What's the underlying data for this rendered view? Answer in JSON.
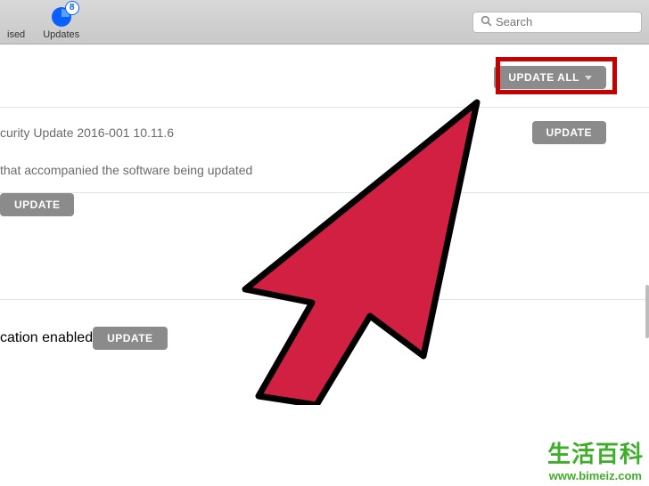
{
  "toolbar": {
    "purchased_label": "ised",
    "updates_label": "Updates",
    "updates_badge": "8",
    "search_placeholder": "Search"
  },
  "buttons": {
    "update_all": "UPDATE ALL",
    "update": "UPDATE"
  },
  "rows": {
    "item1_title": "curity Update 2016-001 10.11.6",
    "item1_desc": "that accompanied the software being updated",
    "item4_title": "cation enabled"
  },
  "watermark": {
    "main": "生活百科",
    "url": "www.bimeiz.com"
  }
}
